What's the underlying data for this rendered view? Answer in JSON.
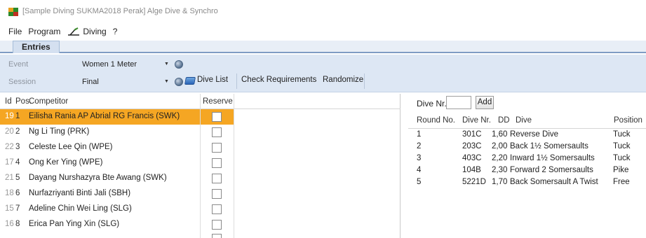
{
  "window": {
    "title": "[Sample Diving SUKMA2018 Perak] Alge Dive & Synchro",
    "icon": "app-logo-icon"
  },
  "menu": {
    "items": [
      {
        "label": "File"
      },
      {
        "label": "Program"
      },
      {
        "label": "Diving",
        "icon": "diving-board-icon"
      },
      {
        "label": "?"
      }
    ]
  },
  "tabs": [
    {
      "label": "Entries",
      "active": true
    }
  ],
  "toolbar": {
    "event": {
      "label": "Event",
      "value": "Women 1 Meter"
    },
    "session": {
      "label": "Session",
      "value": "Final"
    },
    "dive_list_label": "Dive List",
    "check_requirements_label": "Check Requirements",
    "randomize_label": "Randomize"
  },
  "entries": {
    "columns": {
      "id": "Id",
      "pos": "Pos.",
      "competitor": "Competitor",
      "reserve": "Reserve"
    },
    "rows": [
      {
        "id": "19",
        "pos": "1",
        "competitor": "Eilisha Rania AP Abrial RG Francis (SWK)",
        "reserve": false,
        "selected": true
      },
      {
        "id": "20",
        "pos": "2",
        "competitor": "Ng Li Ting (PRK)",
        "reserve": false
      },
      {
        "id": "22",
        "pos": "3",
        "competitor": "Celeste Lee Qin (WPE)",
        "reserve": false
      },
      {
        "id": "17",
        "pos": "4",
        "competitor": "Ong Ker Ying (WPE)",
        "reserve": false
      },
      {
        "id": "21",
        "pos": "5",
        "competitor": "Dayang Nurshazyra Bte Awang (SWK)",
        "reserve": false
      },
      {
        "id": "18",
        "pos": "6",
        "competitor": "Nurfazriyanti Binti Jali (SBH)",
        "reserve": false
      },
      {
        "id": "15",
        "pos": "7",
        "competitor": "Adeline Chin Wei Ling (SLG)",
        "reserve": false
      },
      {
        "id": "16",
        "pos": "8",
        "competitor": "Erica Pan Ying Xin (SLG)",
        "reserve": false
      },
      {
        "id": "",
        "pos": "",
        "competitor": "",
        "reserve": false
      }
    ]
  },
  "dives": {
    "dive_nr_label": "Dive Nr.",
    "dive_nr_value": "",
    "add_label": "Add",
    "columns": {
      "round": "Round No.",
      "dive_nr": "Dive Nr.",
      "dd": "DD",
      "dive": "Dive",
      "position": "Position"
    },
    "rows": [
      {
        "round": "1",
        "dive_nr": "301C",
        "dd": "1,60",
        "dive": "Reverse Dive",
        "position": "Tuck"
      },
      {
        "round": "2",
        "dive_nr": "203C",
        "dd": "2,00",
        "dive": "Back 1½ Somersaults",
        "position": "Tuck"
      },
      {
        "round": "3",
        "dive_nr": "403C",
        "dd": "2,20",
        "dive": "Inward 1½ Somersaults",
        "position": "Tuck"
      },
      {
        "round": "4",
        "dive_nr": "104B",
        "dd": "2,30",
        "dive": "Forward 2 Somersaults",
        "position": "Pike"
      },
      {
        "round": "5",
        "dive_nr": "5221D",
        "dd": "1,70",
        "dive": "Back Somersault A Twist",
        "position": "Free"
      }
    ]
  },
  "colors": {
    "selection": "#f5a623",
    "toolbar_bg": "#dde7f4",
    "tab_border": "#7f9cc4"
  }
}
